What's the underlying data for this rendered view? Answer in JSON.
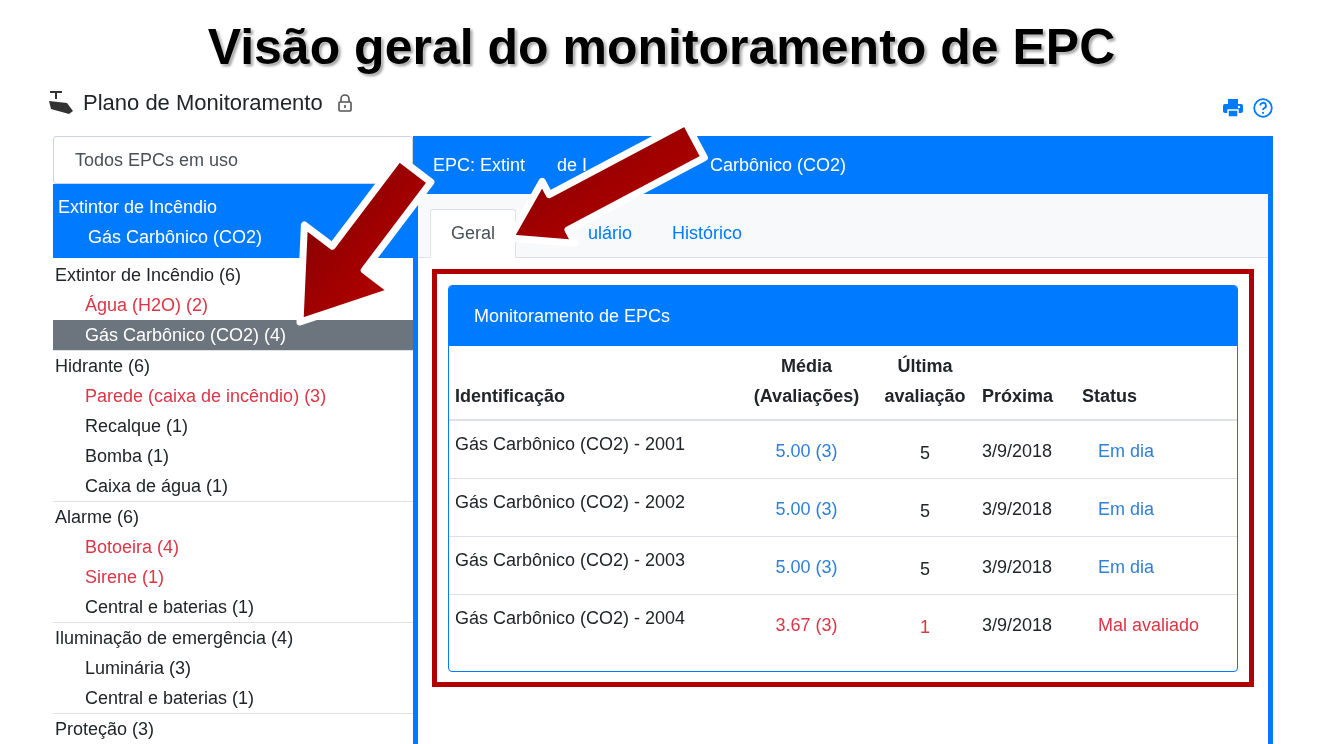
{
  "banner_title": "Visão geral do monitoramento de EPC",
  "page": {
    "title": "Plano de Monitoramento"
  },
  "sidebar": {
    "filter": "Todos EPCs em uso",
    "current": {
      "category": "Extintor de Incêndio",
      "item": "Gás Carbônico (CO2)"
    },
    "groups": [
      {
        "label": "Extintor de Incêndio (6)",
        "children": [
          {
            "label": "Água (H2O) (2)",
            "alert": true,
            "selected": false
          },
          {
            "label": "Gás Carbônico (CO2) (4)",
            "selected": true
          }
        ]
      },
      {
        "label": "Hidrante (6)",
        "children": [
          {
            "label": "Parede (caixa de incêndio) (3)",
            "alert": true,
            "selected": false
          },
          {
            "label": "Recalque (1)",
            "alert": false,
            "selected": false
          },
          {
            "label": "Bomba (1)",
            "alert": false,
            "selected": false
          },
          {
            "label": "Caixa de água (1)",
            "alert": false,
            "selected": false
          }
        ]
      },
      {
        "label": "Alarme (6)",
        "children": [
          {
            "label": "Botoeira (4)",
            "alert": true,
            "selected": false
          },
          {
            "label": "Sirene (1)",
            "alert": true,
            "selected": false
          },
          {
            "label": "Central e baterias (1)",
            "alert": false,
            "selected": false
          }
        ]
      },
      {
        "label": "Iluminação de emergência (4)",
        "children": [
          {
            "label": "Luminária (3)",
            "alert": false,
            "selected": false
          },
          {
            "label": "Central e baterias (1)",
            "alert": false,
            "selected": false
          }
        ]
      },
      {
        "label": "Proteção (3)"
      }
    ]
  },
  "panel": {
    "title_fragments": [
      "EPC: Extint",
      "de I",
      "Carbônico (CO2)"
    ],
    "tabs": [
      {
        "label": "Geral",
        "selected": true
      },
      {
        "label": "ulário",
        "selected": false
      },
      {
        "label": "Histórico",
        "selected": false
      }
    ],
    "card": {
      "title": "Monitoramento de EPCs",
      "columns": [
        "Identificação",
        "Média (Avaliações)",
        "Última avaliação",
        "Próxima",
        "Status"
      ],
      "rows": [
        {
          "id": "Gás Carbônico (CO2) - 2001",
          "average": "5.00 (3)",
          "last": "5",
          "next": "3/9/2018",
          "status": "Em dia",
          "alert": false
        },
        {
          "id": "Gás Carbônico (CO2) - 2002",
          "average": "5.00 (3)",
          "last": "5",
          "next": "3/9/2018",
          "status": "Em dia",
          "alert": false
        },
        {
          "id": "Gás Carbônico (CO2) - 2003",
          "average": "5.00 (3)",
          "last": "5",
          "next": "3/9/2018",
          "status": "Em dia",
          "alert": false
        },
        {
          "id": "Gás Carbônico (CO2) - 2004",
          "average": "3.67 (3)",
          "last": "1",
          "next": "3/9/2018",
          "status": "Mal avaliado",
          "alert": true
        }
      ]
    }
  }
}
